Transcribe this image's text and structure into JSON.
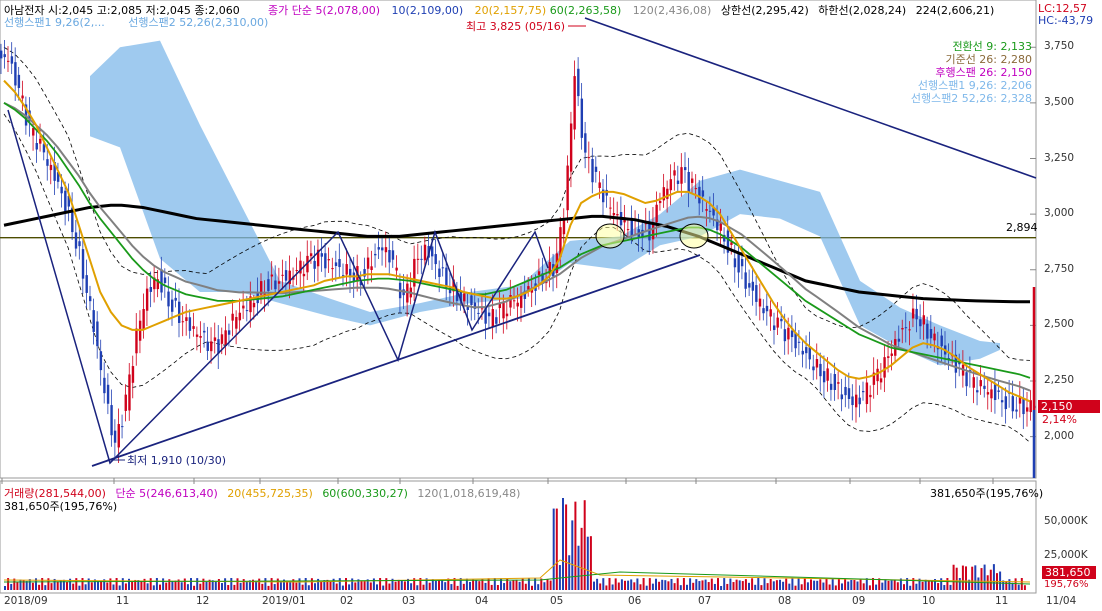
{
  "header": {
    "stock_info": "아남전자 시:2,045 고:2,085 저:2,045 종:2,060",
    "ma_label": "종가 단순 5(2,078,00)",
    "ma10": "10(2,109,00)",
    "ma20": "20(2,157,75)",
    "ma60": "60(2,263,58)",
    "ma120": "120(2,436,08)",
    "upper_band": "상한선(2,295,42)",
    "lower_band": "하한선(2,028,24)",
    "ma224": "224(2,606,21)",
    "span_line": "선행스팬1 9,26(2,...",
    "span_line2": "선행스팬2 52,26(2,310,00)",
    "lc": "LC:12,57",
    "hc": "HC:-43,79"
  },
  "ichimoku": {
    "conversion": "전환선 9: 2,133",
    "base": "기준선 26: 2,280",
    "lagging": "후행스팬 26: 2,150",
    "span1": "선행스팬1 9,26: 2,206",
    "span2": "선행스팬2 52,26: 2,328"
  },
  "annotations": {
    "high": "최고 3,825 (05/16)",
    "low": "최저 1,910 (10/30)",
    "hline_value": "2,894",
    "last_price_tag": "2,150",
    "last_price_pct": "2,14%"
  },
  "price_axis": [
    "3,750",
    "3,500",
    "3,250",
    "3,000",
    "2,750",
    "2,500",
    "2,250",
    "2,000"
  ],
  "volume_header": {
    "label": "거래량(281,544,00)",
    "ma5": "단순 5(246,613,40)",
    "ma20": "20(455,725,35)",
    "ma60": "60(600,330,27)",
    "ma120": "120(1,018,619,48)",
    "right_value": "381,650주(195,76%)",
    "left_value": "381,650주(195,76%)"
  },
  "volume_axis": [
    "50,000K",
    "25,000K"
  ],
  "volume_tag": "381,650",
  "volume_pct": "195,76%",
  "x_axis": [
    "2018/09",
    "11",
    "12",
    "2019/01",
    "02",
    "03",
    "04",
    "05",
    "06",
    "07",
    "08",
    "09",
    "10",
    "11",
    "11/04"
  ],
  "colors": {
    "up": "#d0021b",
    "down": "#1f3fb3",
    "ma5": "#c000c0",
    "ma20": "#e0a000",
    "ma60": "#1a9a1a",
    "ma120": "#808080",
    "ma224": "#000000",
    "cloud": "#7fb8ea",
    "trend": "#1a237e"
  },
  "chart_data": {
    "type": "candlestick",
    "ylim": [
      1850,
      3850
    ],
    "hline": 2894,
    "high_point": {
      "date": "05/16",
      "value": 3825
    },
    "low_point": {
      "date": "10/30",
      "value": 1910
    },
    "close_series": [
      3700,
      3550,
      3380,
      3300,
      3200,
      3100,
      2950,
      2750,
      2500,
      2200,
      1950,
      2150,
      2450,
      2650,
      2720,
      2620,
      2550,
      2500,
      2450,
      2400,
      2420,
      2520,
      2580,
      2620,
      2680,
      2700,
      2720,
      2740,
      2780,
      2800,
      2770,
      2760,
      2740,
      2720,
      2800,
      2850,
      2780,
      2600,
      2760,
      2840,
      2780,
      2700,
      2650,
      2600,
      2560,
      2520,
      2560,
      2600,
      2620,
      2680,
      2720,
      2760,
      3000,
      3620,
      3250,
      3150,
      3050,
      2990,
      2950,
      2930,
      2920,
      3080,
      3150,
      3180,
      3120,
      3050,
      2990,
      2900,
      2800,
      2700,
      2620,
      2550,
      2500,
      2450,
      2400,
      2350,
      2300,
      2250,
      2200,
      2150,
      2180,
      2250,
      2320,
      2420,
      2500,
      2560,
      2480,
      2420,
      2350,
      2300,
      2250,
      2220,
      2200,
      2170,
      2150,
      2140,
      2150
    ],
    "ma20_series": [
      3600,
      3550,
      3480,
      3400,
      3300,
      3200,
      3100,
      2950,
      2800,
      2650,
      2560,
      2500,
      2480,
      2480,
      2500,
      2520,
      2540,
      2560,
      2570,
      2580,
      2590,
      2600,
      2610,
      2620,
      2630,
      2640,
      2650,
      2660,
      2670,
      2680,
      2700,
      2710,
      2720,
      2720,
      2730,
      2730,
      2730,
      2720,
      2710,
      2700,
      2690,
      2680,
      2670,
      2650,
      2640,
      2630,
      2620,
      2620,
      2630,
      2650,
      2680,
      2720,
      2800,
      2950,
      3050,
      3080,
      3100,
      3100,
      3090,
      3070,
      3050,
      3060,
      3080,
      3100,
      3100,
      3080,
      3050,
      3000,
      2920,
      2840,
      2760,
      2680,
      2600,
      2530,
      2470,
      2420,
      2380,
      2340,
      2300,
      2270,
      2260,
      2270,
      2290,
      2320,
      2360,
      2400,
      2420,
      2410,
      2390,
      2360,
      2320,
      2290,
      2260,
      2230,
      2200,
      2180,
      2158
    ],
    "ma60_series": [
      3500,
      3470,
      3430,
      3380,
      3330,
      3270,
      3200,
      3130,
      3050,
      2980,
      2920,
      2860,
      2800,
      2750,
      2710,
      2680,
      2660,
      2640,
      2630,
      2620,
      2610,
      2610,
      2610,
      2615,
      2620,
      2625,
      2630,
      2640,
      2650,
      2660,
      2670,
      2680,
      2690,
      2700,
      2705,
      2710,
      2710,
      2705,
      2700,
      2690,
      2680,
      2670,
      2660,
      2650,
      2640,
      2640,
      2650,
      2660,
      2680,
      2700,
      2720,
      2740,
      2760,
      2790,
      2820,
      2840,
      2860,
      2870,
      2880,
      2890,
      2900,
      2910,
      2920,
      2930,
      2940,
      2940,
      2930,
      2910,
      2880,
      2850,
      2810,
      2770,
      2730,
      2690,
      2650,
      2610,
      2580,
      2550,
      2520,
      2490,
      2460,
      2440,
      2420,
      2400,
      2390,
      2380,
      2370,
      2360,
      2350,
      2340,
      2330,
      2320,
      2310,
      2300,
      2290,
      2280,
      2264
    ],
    "ma224_series": [
      2950,
      2960,
      2970,
      2980,
      2990,
      3000,
      3010,
      3020,
      3030,
      3035,
      3040,
      3040,
      3035,
      3030,
      3020,
      3010,
      3000,
      2990,
      2980,
      2975,
      2970,
      2965,
      2960,
      2955,
      2950,
      2945,
      2940,
      2935,
      2930,
      2925,
      2920,
      2915,
      2910,
      2905,
      2900,
      2900,
      2900,
      2900,
      2905,
      2910,
      2915,
      2920,
      2925,
      2930,
      2935,
      2940,
      2945,
      2950,
      2955,
      2960,
      2965,
      2970,
      2975,
      2980,
      2985,
      2990,
      2990,
      2985,
      2980,
      2975,
      2965,
      2955,
      2945,
      2930,
      2915,
      2900,
      2880,
      2860,
      2840,
      2820,
      2800,
      2780,
      2760,
      2740,
      2720,
      2700,
      2690,
      2680,
      2670,
      2660,
      2650,
      2645,
      2640,
      2635,
      2630,
      2625,
      2620,
      2618,
      2616,
      2614,
      2612,
      2610,
      2609,
      2608,
      2607,
      2606,
      2606
    ]
  }
}
